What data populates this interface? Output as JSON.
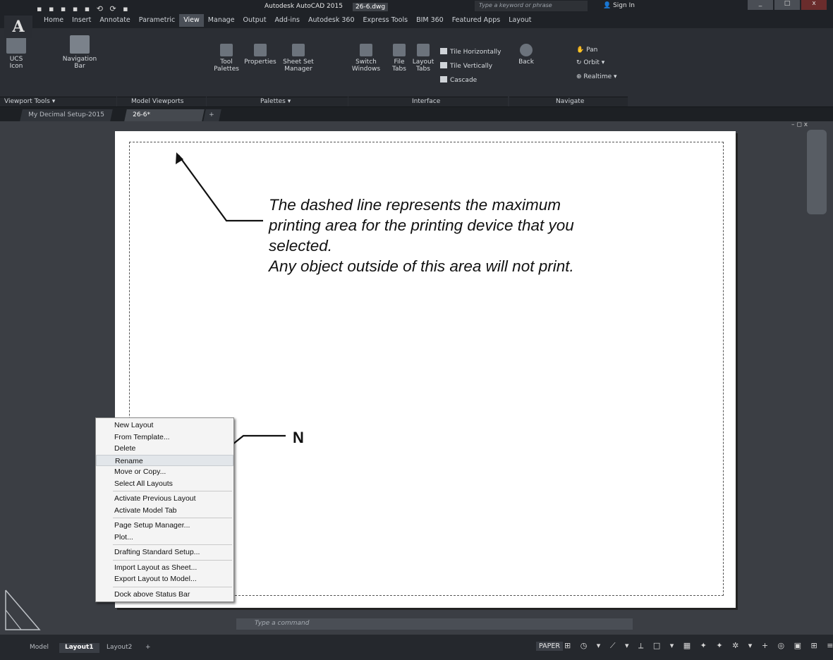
{
  "window": {
    "title": "Autodesk AutoCAD 2015",
    "file_name": "26-6.dwg",
    "search_placeholder": "Type a keyword or phrase",
    "sign_in": "Sign In",
    "quick_access": "▪ ▪ ▪ ▪ ▪ ⟲ ⟳ ▪"
  },
  "ribbon": {
    "tabs": [
      "Home",
      "Insert",
      "Annotate",
      "Parametric",
      "View",
      "Manage",
      "Output",
      "Add-ins",
      "Autodesk 360",
      "Express Tools",
      "BIM 360",
      "Featured Apps",
      "Layout"
    ],
    "active_tab": "View",
    "viewport_tools": {
      "ucs_icon": "UCS Icon",
      "navigation_bar": "Navigation Bar",
      "title": "Viewport Tools ▾"
    },
    "model_viewports": {
      "title": "Model Viewports"
    },
    "palettes": {
      "tool_palettes": "Tool Palettes",
      "properties": "Properties",
      "sheet_set_manager": "Sheet Set Manager",
      "title": "Palettes ▾"
    },
    "interface": {
      "switch_windows": "Switch Windows",
      "file_tabs": "File Tabs",
      "layout_tabs": "Layout Tabs",
      "tile_horizontally": "Tile Horizontally",
      "tile_vertically": "Tile Vertically",
      "cascade": "Cascade",
      "title": "Interface"
    },
    "navigate": {
      "back": "Back",
      "pan": "Pan",
      "orbit": "Orbit ▾",
      "realtime": "Realtime ▾",
      "title": "Navigate"
    }
  },
  "file_tabs": [
    "My Decimal Setup-2015",
    "26-6*"
  ],
  "annotation": {
    "lines": [
      "The dashed line represents the maximum",
      "printing area for the printing device that you",
      "selected.",
      "Any object outside of this area will not print."
    ],
    "n_label": "N"
  },
  "context_menu": {
    "groups": [
      [
        "New Layout",
        "From Template...",
        "Delete",
        "Rename",
        "Move or Copy...",
        "Select All Layouts"
      ],
      [
        "Activate Previous Layout",
        "Activate Model Tab"
      ],
      [
        "Page Setup Manager...",
        "Plot..."
      ],
      [
        "Drafting Standard Setup..."
      ],
      [
        "Import Layout as Sheet...",
        "Export Layout to Model..."
      ],
      [
        "Dock above Status Bar"
      ]
    ],
    "highlighted": "Rename"
  },
  "command_line": {
    "placeholder": "Type a command"
  },
  "status_bar": {
    "layout_tabs": [
      "Model",
      "Layout1",
      "Layout2"
    ],
    "active_layout": "Layout1",
    "add_tab": "+",
    "paper": "PAPER",
    "icons": "⊞ ◷ ▾ ⟋ ▾ ⟂ □ ▾ ▦ ✦ ✦ ✲ ▾ + ◎ ▣ ⊞ ≡"
  },
  "colors": {
    "ribbon_bg": "#2b2e34",
    "title_bg": "#1f2227",
    "drawing_bg": "#3b3e44",
    "paper": "#ffffff",
    "menu_bg": "#f4f4f4"
  }
}
